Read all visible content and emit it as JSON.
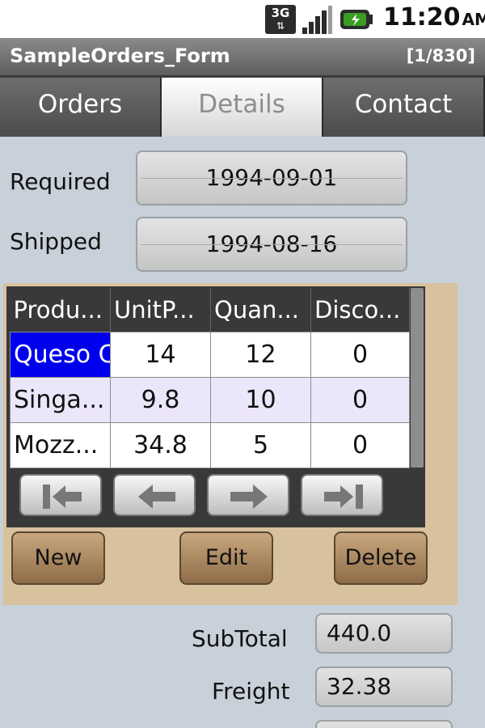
{
  "status_bar": {
    "network": "3G",
    "network_arrows": "⇅",
    "time": "11:20",
    "ampm": "AM",
    "icons": [
      "3g-icon",
      "signal-icon",
      "battery-icon"
    ],
    "signal_level": 0.8,
    "battery_color": "#3a9d23"
  },
  "titlebar": {
    "title": "SampleOrders_Form",
    "record": "[1/830]"
  },
  "tabs": [
    {
      "label": "Orders"
    },
    {
      "label": "Details",
      "selected": true
    },
    {
      "label": "Contact"
    }
  ],
  "form": {
    "required_label": "Required",
    "required_value": "1994-09-01",
    "shipped_label": "Shipped",
    "shipped_value": "1994-08-16"
  },
  "grid": {
    "headers": [
      "Produ...",
      "UnitP...",
      "Quan...",
      "Disco..."
    ],
    "rows": [
      {
        "product": "Queso C",
        "unit_price": "14",
        "quantity": "12",
        "discount": "0"
      },
      {
        "product": "Singa...",
        "unit_price": "9.8",
        "quantity": "10",
        "discount": "0"
      },
      {
        "product": "Mozz...",
        "unit_price": "34.8",
        "quantity": "5",
        "discount": "0"
      }
    ],
    "nav_icons": [
      "first-record-icon",
      "previous-record-icon",
      "next-record-icon",
      "last-record-icon"
    ]
  },
  "buttons": {
    "new": "New",
    "edit": "Edit",
    "delete": "Delete"
  },
  "totals": {
    "subtotal_label": "SubTotal",
    "subtotal_value": "440.0",
    "freight_label": "Freight",
    "freight_value": "32.38"
  },
  "colors": {
    "selection": "#0000ee",
    "alt_row": "#ece6fb",
    "panel": "#d8c29e",
    "action_button": "#a8865c"
  }
}
